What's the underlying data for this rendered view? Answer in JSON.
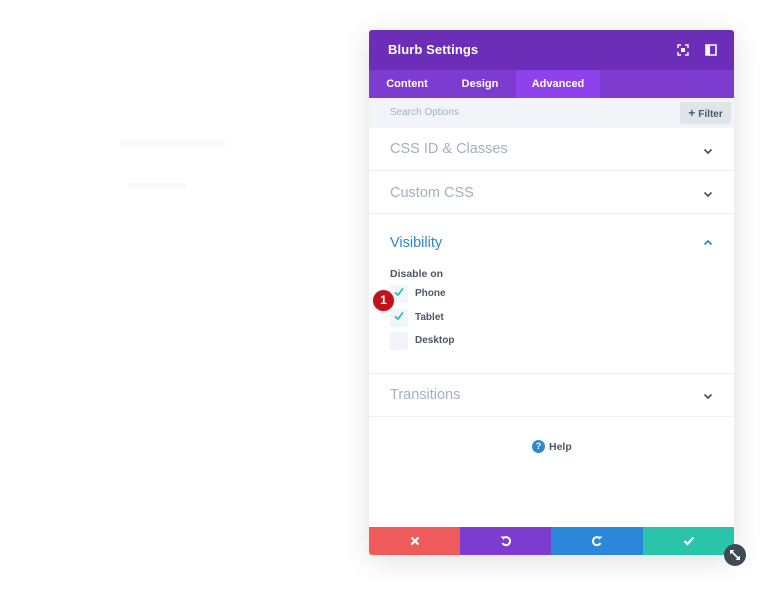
{
  "modal": {
    "title": "Blurb Settings",
    "header_icons": [
      "fullscreen-icon",
      "sidebar-layout-icon"
    ],
    "tabs": [
      {
        "label": "Content",
        "active": false
      },
      {
        "label": "Design",
        "active": false
      },
      {
        "label": "Advanced",
        "active": true
      }
    ],
    "search": {
      "placeholder": "Search Options"
    },
    "filter_label": "Filter",
    "sections": [
      {
        "title": "CSS ID & Classes",
        "expanded": false
      },
      {
        "title": "Custom CSS",
        "expanded": false
      },
      {
        "title": "Visibility",
        "expanded": true
      },
      {
        "title": "Transitions",
        "expanded": false
      }
    ],
    "visibility": {
      "disable_on_label": "Disable on",
      "options": [
        {
          "label": "Phone",
          "checked": true
        },
        {
          "label": "Tablet",
          "checked": true
        },
        {
          "label": "Desktop",
          "checked": false
        }
      ]
    },
    "help": {
      "icon": "?",
      "label": "Help"
    },
    "footer_buttons": [
      {
        "name": "discard-button",
        "icon": "close-icon",
        "color": "#ef5a5a"
      },
      {
        "name": "undo-button",
        "icon": "undo-icon",
        "color": "#7e3bd0"
      },
      {
        "name": "redo-button",
        "icon": "redo-icon",
        "color": "#2b87da"
      },
      {
        "name": "save-button",
        "icon": "checkmark-icon",
        "color": "#29c4a9"
      }
    ]
  },
  "annotation": {
    "step_number": "1"
  },
  "colors": {
    "header": "#6c2eb9",
    "tab_bar": "#7e3bd0",
    "active_tab": "#8f42ec",
    "accent_blue": "#2b87da",
    "check_teal": "#29c4a9",
    "badge_red": "#c3131a"
  }
}
